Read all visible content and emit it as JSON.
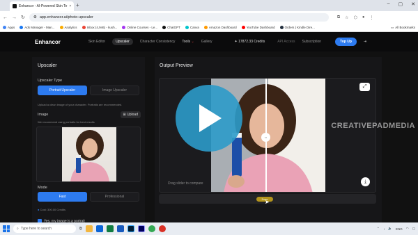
{
  "browser": {
    "tab_title": "Enhancor - AI-Powered Skin Te",
    "tab_close": "×",
    "new_tab": "+",
    "url": "app.enhancor.ai/photo-upscaler",
    "window_controls": [
      "–",
      "▢",
      "✕"
    ],
    "bookmarks": [
      {
        "label": "Apps",
        "color": "#4285f4"
      },
      {
        "label": "Ads Manager - Man...",
        "color": "#1877f2"
      },
      {
        "label": "Analytics",
        "color": "#f9ab00"
      },
      {
        "label": "Inbox (4,946) - kush...",
        "color": "#ea4335"
      },
      {
        "label": "Online Courses - Le...",
        "color": "#a435f0"
      },
      {
        "label": "ChatGPT",
        "color": "#111111"
      },
      {
        "label": "Canva",
        "color": "#00c4cc"
      },
      {
        "label": "Amazon Dashboard",
        "color": "#ff9900"
      },
      {
        "label": "YouTube Dashboard",
        "color": "#ff0000"
      },
      {
        "label": "Orders | Kindle Dire...",
        "color": "#232f3e"
      }
    ],
    "all_bookmarks": "All Bookmarks"
  },
  "app": {
    "brand": "Enhancor",
    "nav": [
      {
        "label": "Skin Editor",
        "active": false
      },
      {
        "label": "Upscaler",
        "active": true
      },
      {
        "label": "Character Consistency",
        "active": false
      },
      {
        "label": "Tools",
        "active": false
      },
      {
        "label": "Gallery",
        "active": false
      }
    ],
    "credits": "17872.33 Credits",
    "api_access": "API Access",
    "subscription": "Subscription",
    "top_up": "Top Up"
  },
  "upscaler": {
    "title": "Upscaler",
    "type_label": "Upscaler Type",
    "type_options": [
      "Portrait Upscaler",
      "Image Upscaler"
    ],
    "type_selected": "Portrait Upscaler",
    "type_hint": "Upload a clean image of your character. Portraits are recommended.",
    "image_label": "Image",
    "image_hint": "We recommend using portraits for best results",
    "upload_label": "Upload",
    "mode_label": "Mode",
    "mode_options": [
      "Fast",
      "Professional"
    ],
    "mode_selected": "Fast",
    "cost": "Cost: 300.00 Credits",
    "portrait_check": "Yes, my image is a portrait"
  },
  "preview": {
    "title": "Output Preview",
    "drag_hint": "Drag slider to compare",
    "zoom_label": "Zoom"
  },
  "overlay": {
    "watermark": "CREATIVEPADMEDIA"
  },
  "taskbar": {
    "search_placeholder": "Type here to search",
    "lang": "ENG",
    "time": "",
    "apps": [
      {
        "name": "file-explorer",
        "color": "#f3b63f"
      },
      {
        "name": "mail",
        "color": "#0a64d6"
      },
      {
        "name": "excel",
        "color": "#107c41"
      },
      {
        "name": "word",
        "color": "#185abd"
      },
      {
        "name": "photoshop",
        "color": "#31a8ff"
      },
      {
        "name": "premiere",
        "color": "#9999ff"
      },
      {
        "name": "chrome",
        "color": "#34a853"
      },
      {
        "name": "recorder",
        "color": "#d93025"
      }
    ]
  },
  "colors": {
    "accent": "#2d7bf0",
    "play": "#2c9bc9",
    "bg": "#111111"
  }
}
